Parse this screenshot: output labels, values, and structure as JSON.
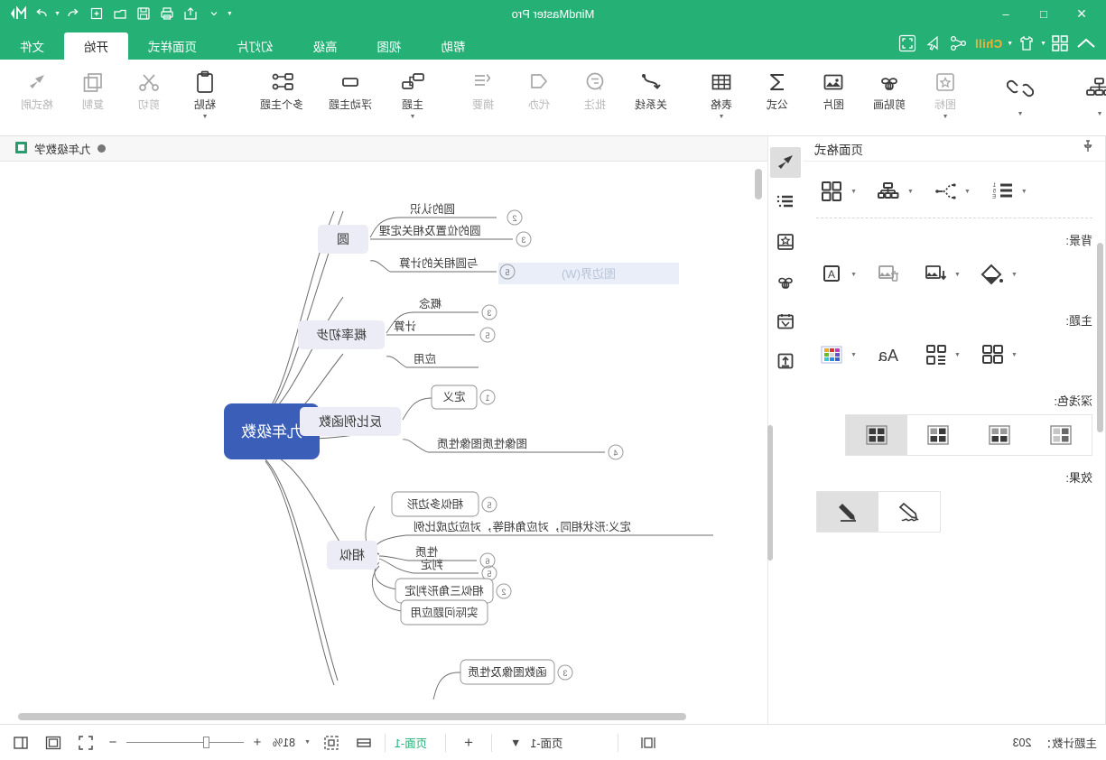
{
  "window": {
    "title": "MindMaster Pro",
    "minimize_label": "–",
    "maximize_label": "□",
    "close_label": "✕"
  },
  "quick_access": [
    {
      "name": "collapse-ribbon-icon",
      "label": ""
    },
    {
      "name": "caret-down-icon",
      "label": ""
    },
    {
      "name": "share-export-icon",
      "label": ""
    },
    {
      "name": "print-icon",
      "label": ""
    },
    {
      "name": "save-icon",
      "label": ""
    },
    {
      "name": "open-folder-icon",
      "label": ""
    },
    {
      "name": "new-file-icon",
      "label": ""
    },
    {
      "name": "undo-icon",
      "label": ""
    },
    {
      "name": "redo-icon",
      "label": ""
    },
    {
      "name": "mindmaster-logo-icon",
      "label": ""
    }
  ],
  "left_tools": [
    {
      "name": "home-chevron-icon",
      "label": ""
    },
    {
      "name": "apps-grid-icon",
      "label": ""
    },
    {
      "name": "shirt-theme-icon",
      "label": ""
    },
    {
      "name": "chill-mode-button",
      "label": "Chill"
    },
    {
      "name": "share-node-icon",
      "label": ""
    },
    {
      "name": "cursor-arrow-icon",
      "label": ""
    },
    {
      "name": "fullscreen-icon",
      "label": ""
    }
  ],
  "tabs": [
    {
      "label": "文件",
      "active": false
    },
    {
      "label": "开始",
      "active": true
    },
    {
      "label": "页面样式",
      "active": false
    },
    {
      "label": "幻灯片",
      "active": false
    },
    {
      "label": "高级",
      "active": false
    },
    {
      "label": "视图",
      "active": false
    },
    {
      "label": "帮助",
      "active": false
    }
  ],
  "ribbon": {
    "clipboard": [
      {
        "label": "粘贴",
        "icon": "paste-icon",
        "dim": false,
        "caret": true
      },
      {
        "label": "剪切",
        "icon": "scissors-icon",
        "dim": true,
        "caret": false
      },
      {
        "label": "复制",
        "icon": "copy-icon",
        "dim": true,
        "caret": false
      },
      {
        "label": "格式刷",
        "icon": "format-painter-icon",
        "dim": true,
        "caret": false
      }
    ],
    "theme": [
      {
        "label": "主题",
        "icon": "theme-icon",
        "dim": false,
        "caret": true
      }
    ],
    "topics": [
      {
        "label": "主题",
        "icon": "topic-icon",
        "dim": false,
        "caret": true
      },
      {
        "label": "浮动主题",
        "icon": "floating-topic-icon",
        "dim": false,
        "caret": false
      },
      {
        "label": "多个主题",
        "icon": "multi-topic-icon",
        "dim": false,
        "caret": false
      }
    ],
    "insert": [
      {
        "label": "关系线",
        "icon": "relationship-line-icon",
        "dim": false,
        "caret": false
      },
      {
        "label": "批注",
        "icon": "comment-icon",
        "dim": true,
        "caret": false
      },
      {
        "label": "代办",
        "icon": "callout-icon",
        "dim": true,
        "caret": false
      },
      {
        "label": "摘要",
        "icon": "summary-icon",
        "dim": true,
        "caret": false
      }
    ],
    "media": [
      {
        "label": "图标",
        "icon": "icon-library-icon",
        "dim": true,
        "caret": true
      },
      {
        "label": "剪贴画",
        "icon": "clipart-icon",
        "dim": false,
        "caret": false
      },
      {
        "label": "图片",
        "icon": "image-icon",
        "dim": false,
        "caret": false
      },
      {
        "label": "公式",
        "icon": "formula-icon",
        "dim": false,
        "caret": false
      },
      {
        "label": "表格",
        "icon": "table-icon",
        "dim": false,
        "caret": true
      }
    ],
    "link": [
      {
        "label": "",
        "icon": "hyperlink-icon",
        "dim": false,
        "caret": true
      }
    ],
    "layout": [
      {
        "label": "",
        "icon": "layout-structure-icon",
        "dim": false,
        "caret": true
      }
    ]
  },
  "panel": {
    "title": "页面格式",
    "pin_icon": "pin-icon",
    "row_top": [
      {
        "name": "page-layout-grid-icon",
        "caret": true
      },
      {
        "name": "structure-icon",
        "caret": true
      },
      {
        "name": "branch-style-icon",
        "caret": true
      },
      {
        "name": "numbering-icon",
        "caret": true
      }
    ],
    "sections": [
      {
        "label": "背景:",
        "items": [
          {
            "name": "fill-color-icon",
            "caret": true
          },
          {
            "name": "insert-background-image-icon",
            "caret": true
          },
          {
            "name": "remove-background-image-icon",
            "caret": false
          },
          {
            "name": "watermark-text-icon",
            "caret": true
          }
        ]
      },
      {
        "label": "主题:",
        "items": [
          {
            "name": "theme-gallery-icon",
            "caret": true
          },
          {
            "name": "theme-style-icon",
            "caret": true
          },
          {
            "name": "font-style-icon",
            "caret": false
          },
          {
            "name": "color-palette-icon",
            "caret": true
          }
        ]
      }
    ],
    "shade": {
      "label": "深浅色:",
      "options": [
        {
          "name": "shade-option-1",
          "active": false
        },
        {
          "name": "shade-option-2",
          "active": false
        },
        {
          "name": "shade-option-3",
          "active": false
        },
        {
          "name": "shade-option-4",
          "active": true
        }
      ]
    },
    "effect": {
      "label": "效果:",
      "options": [
        {
          "name": "effect-sketch",
          "active": false
        },
        {
          "name": "effect-solid",
          "active": true
        }
      ]
    },
    "vstrip": [
      {
        "name": "format-brush-tool",
        "active": true
      },
      {
        "name": "outline-list-tool",
        "active": false
      },
      {
        "name": "style-library-tool",
        "active": false
      },
      {
        "name": "clipart-tool",
        "active": false
      },
      {
        "name": "task-calendar-tool",
        "active": false
      },
      {
        "name": "export-tool",
        "active": false
      }
    ]
  },
  "document": {
    "tab_title": "九年级数学",
    "tab_icon": "document-icon"
  },
  "mindmap": {
    "root": "九年级数",
    "watermark": "图边界(W)",
    "branches": [
      {
        "title": "圆",
        "children": [
          {
            "badge": "2",
            "label": "圆的认识"
          },
          {
            "badge": "3",
            "label": "圆的位置及相关定理"
          },
          {
            "badge": "5",
            "label": "与圆相关的计算"
          }
        ]
      },
      {
        "title": "概率初步",
        "children": [
          {
            "badge": "3",
            "label": "概念"
          },
          {
            "badge": "5",
            "label": "计算"
          },
          {
            "badge": "",
            "label": "应用"
          }
        ]
      },
      {
        "title": "反比例函数",
        "children": [
          {
            "badge": "1",
            "label": "定义"
          },
          {
            "badge": "4",
            "label": "图像性质图像性质"
          }
        ]
      },
      {
        "title": "相似",
        "children": [
          {
            "badge": "5",
            "label": "相似多边形"
          },
          {
            "badge": "",
            "label": "定义:形状相同，对应角相等，对应边成比例"
          },
          {
            "badge": "6",
            "label": "性质"
          },
          {
            "badge": "5",
            "label": "判定"
          },
          {
            "badge": "2",
            "label": "相似三角形判定"
          },
          {
            "badge": "",
            "label": "实际问题应用"
          }
        ]
      },
      {
        "title": "",
        "children": [
          {
            "badge": "3",
            "label": "函数图像及性质"
          }
        ]
      }
    ]
  },
  "status": {
    "topic_count_label": "主题计数：",
    "topic_count_value": "203",
    "zoom_value": "81%",
    "zoom_minus": "−",
    "zoom_plus": "+",
    "page_label_right": "页面-1",
    "page_label_active": "页面-1",
    "add_page_label": "+",
    "page_menu_label": "▼",
    "buttons": [
      {
        "name": "outline-view-button"
      },
      {
        "name": "fit-to-screen-button"
      },
      {
        "name": "full-screen-button"
      },
      {
        "name": "focus-mode-button"
      },
      {
        "name": "single-page-button"
      },
      {
        "name": "panel-toggle-button"
      }
    ]
  },
  "colors": {
    "brand_green": "#25b075",
    "accent_amber": "#f5b335",
    "root_node_blue": "#3b5fb8",
    "branch_node_bg": "#ebecf5",
    "selected_gray": "#dedede"
  }
}
